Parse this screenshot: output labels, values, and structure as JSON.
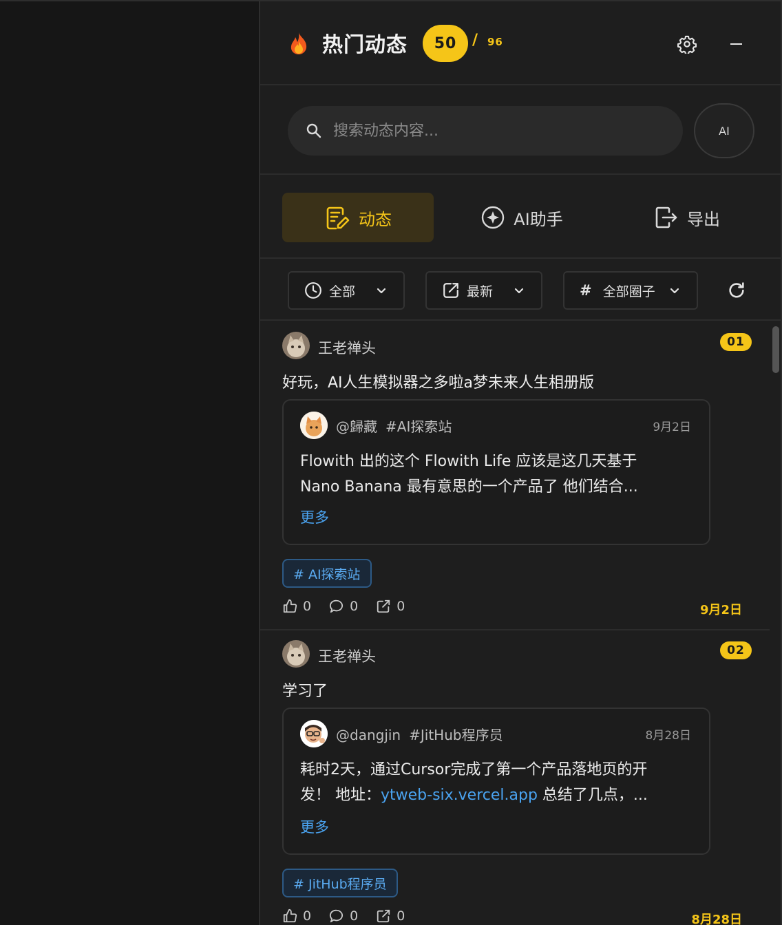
{
  "header": {
    "title": "热门动态",
    "count": "50",
    "separator": "/",
    "total": "96"
  },
  "search": {
    "placeholder": "搜索动态内容...",
    "ai_label": "AI"
  },
  "tabs": [
    {
      "label": "动态",
      "active": true,
      "icon": "edit-note-icon"
    },
    {
      "label": "AI助手",
      "active": false,
      "icon": "ai-sparkle-icon"
    },
    {
      "label": "导出",
      "active": false,
      "icon": "export-icon"
    }
  ],
  "filters": {
    "range": "全部",
    "sort": "最新",
    "circle": "全部圈子"
  },
  "colors": {
    "accent": "#f5c518",
    "link": "#4aa3f0",
    "background": "#1e1e1e"
  },
  "posts": [
    {
      "author": "王老禅头",
      "rank": "01",
      "text": "好玩，AI人生模拟器之多啦a梦未来人生相册版",
      "quote": {
        "user": "@歸藏",
        "topic": "#AI探索站",
        "date": "9月2日",
        "line1": "Flowith 出的这个 Flowith Life 应该是这几天基于",
        "line2": "Nano Banana 最有意思的一个产品了 他们结合...",
        "more": "更多"
      },
      "tag": "# AI探索站",
      "likes": "0",
      "comments": "0",
      "shares": "0",
      "date": "9月2日"
    },
    {
      "author": "王老禅头",
      "rank": "02",
      "text": "学习了",
      "quote": {
        "user": "@dangjin",
        "topic": "#JitHub程序员",
        "date": "8月28日",
        "line1": "耗时2天，通过Cursor完成了第一个产品落地页的开",
        "line2_pre": "发！ 地址：",
        "line2_link": "ytweb-six.vercel.app",
        "line2_post": " 总结了几点，...",
        "more": "更多"
      },
      "tag": "# JitHub程序员",
      "likes": "0",
      "comments": "0",
      "shares": "0",
      "date": "8月28日"
    }
  ]
}
